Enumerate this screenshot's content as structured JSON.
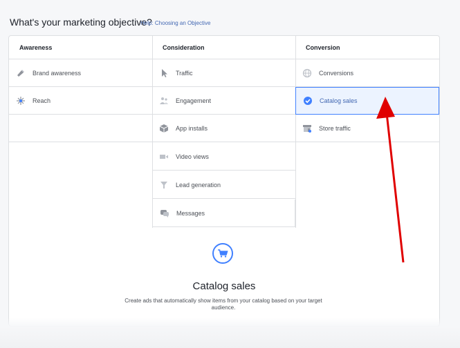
{
  "header": {
    "title": "What's your marketing objective?",
    "help_link": "Help: Choosing an Objective"
  },
  "columns": [
    {
      "heading": "Awareness",
      "items": [
        {
          "label": "Brand awareness",
          "icon": "megaphone-icon"
        },
        {
          "label": "Reach",
          "icon": "reach-icon"
        }
      ]
    },
    {
      "heading": "Consideration",
      "items": [
        {
          "label": "Traffic",
          "icon": "cursor-icon"
        },
        {
          "label": "Engagement",
          "icon": "people-icon"
        },
        {
          "label": "App installs",
          "icon": "box-icon"
        },
        {
          "label": "Video views",
          "icon": "video-camera-icon"
        },
        {
          "label": "Lead generation",
          "icon": "funnel-icon"
        },
        {
          "label": "Messages",
          "icon": "chat-bubbles-icon"
        }
      ]
    },
    {
      "heading": "Conversion",
      "items": [
        {
          "label": "Conversions",
          "icon": "globe-icon"
        },
        {
          "label": "Catalog sales",
          "icon": "check-circle-icon",
          "selected": true
        },
        {
          "label": "Store traffic",
          "icon": "store-icon"
        }
      ]
    }
  ],
  "detail": {
    "icon": "shopping-cart-icon",
    "title": "Catalog sales",
    "description": "Create ads that automatically show items from your catalog based on your target audience."
  },
  "colors": {
    "accent": "#4080ff",
    "selected_bg": "#ecf3ff",
    "annotation_arrow": "#e00000"
  }
}
